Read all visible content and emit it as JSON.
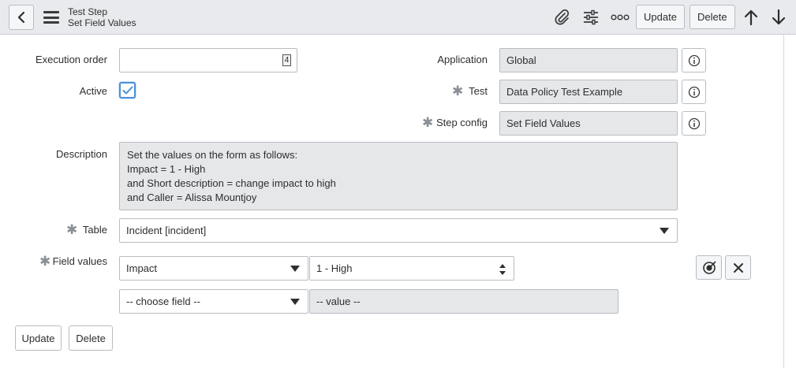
{
  "header": {
    "title_line1": "Test Step",
    "title_line2": "Set Field Values",
    "update_label": "Update",
    "delete_label": "Delete"
  },
  "form": {
    "execution_order": {
      "label": "Execution order",
      "value": "4"
    },
    "active": {
      "label": "Active",
      "checked": true
    },
    "application": {
      "label": "Application",
      "value": "Global"
    },
    "test": {
      "label": "Test",
      "value": "Data Policy Test Example"
    },
    "step_config": {
      "label": "Step config",
      "value": "Set Field Values"
    },
    "description": {
      "label": "Description",
      "lines": [
        "Set the values on the form as follows:",
        "Impact = 1 - High",
        "and Short description = change impact to high",
        "and Caller = Alissa Mountjoy"
      ]
    },
    "table": {
      "label": "Table",
      "value": "Incident [incident]"
    },
    "field_values": {
      "label": "Field values",
      "rows": [
        {
          "field": "Impact",
          "value": "1 - High"
        },
        {
          "field": "-- choose field --",
          "value": "-- value --"
        }
      ]
    }
  },
  "footer": {
    "update_label": "Update",
    "delete_label": "Delete"
  },
  "colors": {
    "header_bg": "#e8eaed",
    "readonly_bg": "#e6e7e9",
    "checkbox_accent": "#4a90d9"
  }
}
